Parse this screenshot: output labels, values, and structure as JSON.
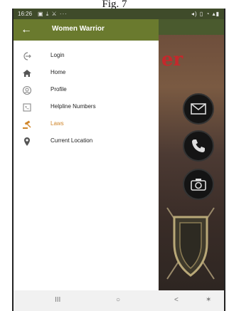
{
  "caption": "Fig. 7",
  "status_bar": {
    "time": "16:26",
    "left_icons": "▣ ⤓ ⚔ ···",
    "right_icons": "◂) ▯ ◔ ▴▮"
  },
  "app_bar": {
    "title": "Women Warrior",
    "back_icon": "arrow-back-icon"
  },
  "menu": [
    {
      "label": "Login",
      "icon": "login-icon"
    },
    {
      "label": "Home",
      "icon": "home-icon"
    },
    {
      "label": "Profile",
      "icon": "profile-icon"
    },
    {
      "label": "Helpline Numbers",
      "icon": "helpline-icon"
    },
    {
      "label": "Laws",
      "icon": "gavel-icon",
      "active": true
    },
    {
      "label": "Current Location",
      "icon": "location-pin-icon"
    }
  ],
  "background_app": {
    "title_fragment": "er"
  },
  "nav_bar": {
    "recents": "III",
    "home": "○",
    "back": "<",
    "accessibility": "✶"
  },
  "colors": {
    "app_bar": "#6a7a2e",
    "active_item": "#d0862b",
    "title_red": "#c5282c"
  }
}
